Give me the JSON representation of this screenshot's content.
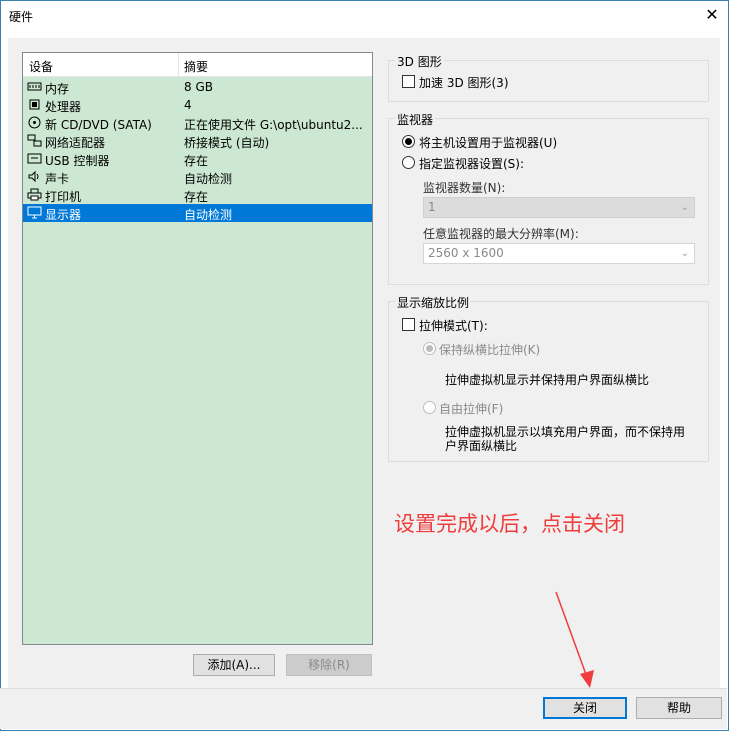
{
  "window": {
    "title": "硬件",
    "close_glyph": "✕"
  },
  "device_list": {
    "headers": {
      "device": "设备",
      "summary": "摘要"
    },
    "rows": [
      {
        "icon": "memory-icon",
        "device": "内存",
        "summary": "8 GB"
      },
      {
        "icon": "processor-icon",
        "device": "处理器",
        "summary": "4"
      },
      {
        "icon": "cd-dvd-icon",
        "device": "新 CD/DVD (SATA)",
        "summary": "正在使用文件 G:\\opt\\ubuntu2..."
      },
      {
        "icon": "network-adapter-icon",
        "device": "网络适配器",
        "summary": "桥接模式 (自动)"
      },
      {
        "icon": "usb-controller-icon",
        "device": "USB 控制器",
        "summary": "存在"
      },
      {
        "icon": "sound-card-icon",
        "device": "声卡",
        "summary": "自动检测"
      },
      {
        "icon": "printer-icon",
        "device": "打印机",
        "summary": "存在"
      },
      {
        "icon": "display-icon",
        "device": "显示器",
        "summary": "自动检测",
        "selected": true
      }
    ],
    "add_button": "添加(A)...",
    "remove_button": "移除(R)",
    "bg_color": "#cde8d2",
    "selected_color": "#0078d7"
  },
  "graphics_3d": {
    "title": "3D 图形",
    "accelerate_label": "加速 3D 图形(3)",
    "accelerate_checked": false
  },
  "monitor": {
    "title": "监视器",
    "host_setting_label": "将主机设置用于监视器(U)",
    "host_setting_selected": true,
    "specify_label": "指定监视器设置(S):",
    "specify_selected": false,
    "count_label": "监视器数量(N):",
    "count_value": "1",
    "max_res_label": "任意监视器的最大分辨率(M):",
    "max_res_value": "2560 x 1600"
  },
  "scaling": {
    "title": "显示缩放比例",
    "stretch_label": "拉伸模式(T):",
    "stretch_checked": false,
    "keep_ratio_label": "保持纵横比拉伸(K)",
    "keep_ratio_selected": true,
    "keep_ratio_desc": "拉伸虚拟机显示并保持用户界面纵横比",
    "free_label": "自由拉伸(F)",
    "free_selected": false,
    "free_desc_line1": "拉伸虚拟机显示以填充用户界面，而不保持用",
    "free_desc_line2": "户界面纵横比"
  },
  "annotation": {
    "text": "设置完成以后，点击关闭",
    "color": "#ef3c3c"
  },
  "footer": {
    "close_button": "关闭",
    "help_button": "帮助"
  }
}
